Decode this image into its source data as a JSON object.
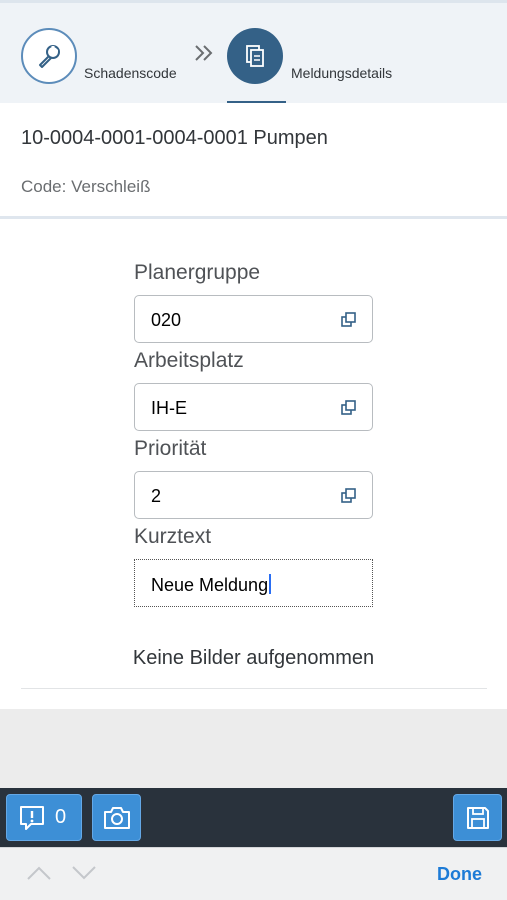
{
  "wizard": {
    "step1_label": "Schadenscode",
    "step2_label": "Meldungsdetails",
    "step1_icon": "wrench-icon",
    "step2_icon": "document-copy-icon",
    "active_color": "#346187"
  },
  "object_header": {
    "title": "10-0004-0001-0004-0001 Pumpen",
    "subtitle": "Code: Verschleiß"
  },
  "form": {
    "fields": [
      {
        "label": "Planergruppe",
        "value": "020"
      },
      {
        "label": "Arbeitsplatz",
        "value": "IH-E"
      },
      {
        "label": "Priorität",
        "value": "2"
      },
      {
        "label": "Kurztext",
        "value": "Neue Meldung"
      }
    ]
  },
  "images": {
    "empty_text": "Keine Bilder aufgenommen"
  },
  "footer": {
    "messages_count": "0",
    "button_color": "#3d8fd6"
  },
  "keyboard_bar": {
    "done_label": "Done"
  }
}
